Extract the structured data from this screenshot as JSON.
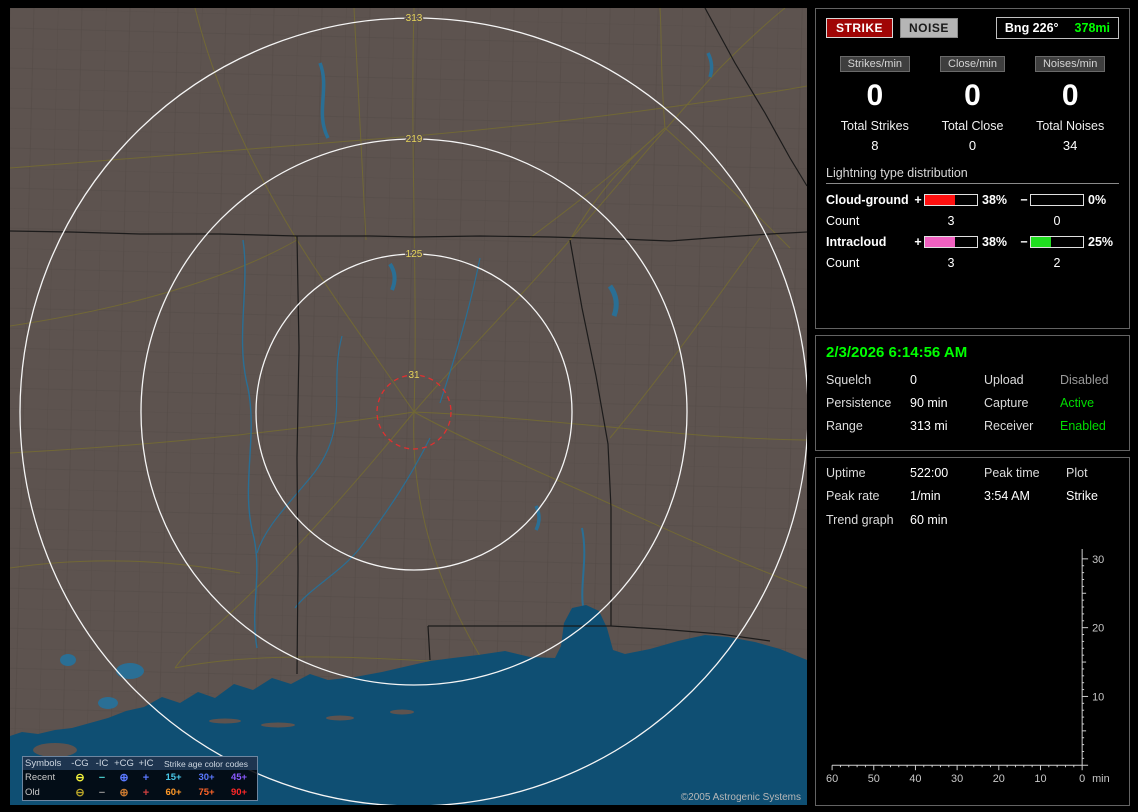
{
  "colors": {
    "accent_green": "#00ff00",
    "strike_red": "#a00505",
    "ring_label_yellow": "#e6d45a",
    "map_land": "#5d534f",
    "map_water": "#0f4f73"
  },
  "header": {
    "strike_button": "STRIKE",
    "noise_button": "NOISE",
    "bearing_label": "Bng 226°",
    "bearing_range": "378mi"
  },
  "rates": {
    "columns": [
      {
        "header": "Strikes/min",
        "value": "0",
        "total_label": "Total Strikes",
        "total_value": "8"
      },
      {
        "header": "Close/min",
        "value": "0",
        "total_label": "Total Close",
        "total_value": "0"
      },
      {
        "header": "Noises/min",
        "value": "0",
        "total_label": "Total Noises",
        "total_value": "34"
      }
    ]
  },
  "distribution": {
    "title": "Lightning type distribution",
    "count_label": "Count",
    "rows": [
      {
        "label": "Cloud-ground",
        "plus_sign": "+",
        "minus_sign": "−",
        "plus_pct": "38%",
        "minus_pct": "0%",
        "plus_count": "3",
        "minus_count": "0",
        "plus_color": "#ff1010",
        "minus_color": "#ff1010",
        "plus_fill": 58,
        "minus_fill": 0
      },
      {
        "label": "Intracloud",
        "plus_sign": "+",
        "minus_sign": "−",
        "plus_pct": "38%",
        "minus_pct": "25%",
        "plus_count": "3",
        "minus_count": "2",
        "plus_color": "#f060c0",
        "minus_color": "#20dd20",
        "plus_fill": 58,
        "minus_fill": 38
      }
    ]
  },
  "status": {
    "datetime": "2/3/2026 6:14:56 AM",
    "rows": [
      {
        "l1": "Squelch",
        "v1": "0",
        "l2": "Upload",
        "v2": "Disabled",
        "v2_color": "#9a9a9a"
      },
      {
        "l1": "Persistence",
        "v1": "90 min",
        "l2": "Capture",
        "v2": "Active",
        "v2_color": "#00dd00"
      },
      {
        "l1": "Range",
        "v1": "313 mi",
        "l2": "Receiver",
        "v2": "Enabled",
        "v2_color": "#00dd00"
      }
    ]
  },
  "stats": {
    "rows": [
      {
        "c1": "Uptime",
        "c2": "522:00",
        "c3": "Peak time",
        "c4": "Plot"
      },
      {
        "c1": "Peak rate",
        "c2": "1/min",
        "c3": "3:54 AM",
        "c4": "Strike"
      }
    ],
    "trend_label": "Trend graph",
    "trend_value": "60 min"
  },
  "chart_data": {
    "type": "line",
    "title": "Trend graph (60 min)",
    "x_ticks": [
      "60",
      "50",
      "40",
      "30",
      "20",
      "10",
      "0"
    ],
    "x_unit": "min",
    "y_ticks": [
      "30",
      "20",
      "10"
    ],
    "xlim": [
      60,
      0
    ],
    "ylim": [
      0,
      30
    ],
    "grid": false,
    "axis_side": "right",
    "series": []
  },
  "map": {
    "ring_labels": [
      "313",
      "219",
      "125",
      "31"
    ],
    "copyright": "©2005 Astrogenic Systems",
    "legend": {
      "symbols_header": "Symbols",
      "age_header": "Strike age color codes",
      "columns": [
        "-CG",
        "-IC",
        "+CG",
        "+IC"
      ],
      "rows": [
        {
          "label": "Recent",
          "symbols": [
            {
              "glyph": "⊖",
              "color": "#f4f43c"
            },
            {
              "glyph": "−",
              "color": "#49c8c8"
            },
            {
              "glyph": "⊕",
              "color": "#5a78ff"
            },
            {
              "glyph": "+",
              "color": "#5a78ff"
            }
          ],
          "ages": [
            {
              "text": "15+",
              "color": "#49c8e8"
            },
            {
              "text": "30+",
              "color": "#5a78ff"
            },
            {
              "text": "45+",
              "color": "#8a5aff"
            }
          ]
        },
        {
          "label": "Old",
          "symbols": [
            {
              "glyph": "⊖",
              "color": "#b8a428"
            },
            {
              "glyph": "−",
              "color": "#8a8a8a"
            },
            {
              "glyph": "⊕",
              "color": "#c87830"
            },
            {
              "glyph": "+",
              "color": "#d04040"
            }
          ],
          "ages": [
            {
              "text": "60+",
              "color": "#ff9928"
            },
            {
              "text": "75+",
              "color": "#ff6428"
            },
            {
              "text": "90+",
              "color": "#ff2828"
            }
          ]
        }
      ]
    }
  }
}
